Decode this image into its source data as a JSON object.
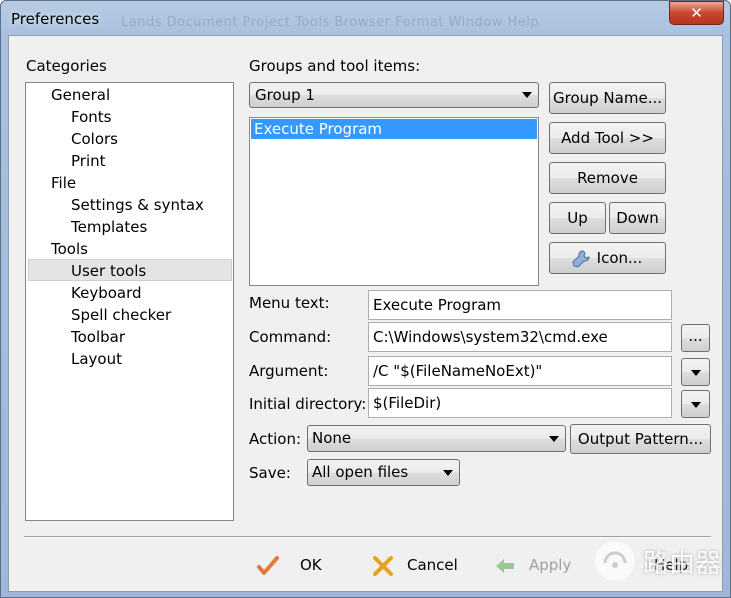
{
  "window": {
    "title": "Preferences",
    "background_menu": "Lands   Document   Project   Tools   Browser   Format   Window   Help",
    "close": "✕"
  },
  "categories": {
    "heading": "Categories",
    "items": [
      {
        "label": "General",
        "level": 0
      },
      {
        "label": "Fonts",
        "level": 1
      },
      {
        "label": "Colors",
        "level": 1
      },
      {
        "label": "Print",
        "level": 1
      },
      {
        "label": "File",
        "level": 0
      },
      {
        "label": "Settings & syntax",
        "level": 1
      },
      {
        "label": "Templates",
        "level": 1
      },
      {
        "label": "Tools",
        "level": 0
      },
      {
        "label": "User tools",
        "level": 1,
        "selected": true
      },
      {
        "label": "Keyboard",
        "level": 1
      },
      {
        "label": "Spell checker",
        "level": 1
      },
      {
        "label": "Toolbar",
        "level": 1
      },
      {
        "label": "Layout",
        "level": 1
      }
    ]
  },
  "groups": {
    "heading": "Groups and tool items:",
    "selected_group": "Group 1",
    "tool_items": [
      "Execute Program"
    ],
    "buttons": {
      "group_name": "Group Name...",
      "add_tool": "Add Tool >>",
      "remove": "Remove",
      "up": "Up",
      "down": "Down",
      "icon": "Icon..."
    }
  },
  "form": {
    "menu_text": {
      "label": "Menu text:",
      "value": "Execute Program"
    },
    "command": {
      "label": "Command:",
      "value": "C:\\Windows\\system32\\cmd.exe",
      "browse": "..."
    },
    "argument": {
      "label": "Argument:",
      "value": "/C \"$(FileNameNoExt)\""
    },
    "initial_directory": {
      "label": "Initial directory:",
      "value": "$(FileDir)"
    },
    "action": {
      "label": "Action:",
      "value": "None",
      "output_pattern": "Output Pattern..."
    },
    "save": {
      "label": "Save:",
      "value": "All open files"
    }
  },
  "footer": {
    "ok": "OK",
    "cancel": "Cancel",
    "apply": "Apply",
    "help": "Help"
  },
  "colors": {
    "selection": "#3399ff",
    "ok_check": "#e07b3c",
    "cancel_x": "#e8a21f",
    "apply_arrow": "#9bc79b"
  },
  "watermark": {
    "text": "路由器"
  }
}
